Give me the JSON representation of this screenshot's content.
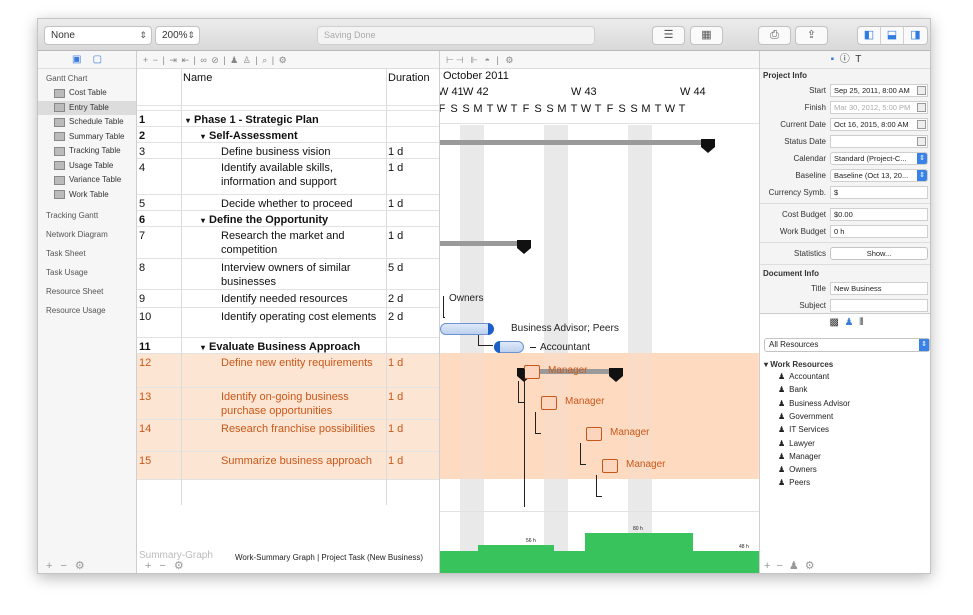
{
  "toolbar": {
    "filter": "None",
    "zoom": "200%",
    "status": "Saving Done"
  },
  "sidebar": {
    "header_icons": [
      "gantt-chart-icon",
      "comment-icon"
    ],
    "gantt_chart": "Gantt Chart",
    "tables": [
      {
        "label": "Cost Table",
        "selected": false
      },
      {
        "label": "Entry Table",
        "selected": true
      },
      {
        "label": "Schedule Table",
        "selected": false
      },
      {
        "label": "Summary Table",
        "selected": false
      },
      {
        "label": "Tracking Table",
        "selected": false
      },
      {
        "label": "Usage Table",
        "selected": false
      },
      {
        "label": "Variance Table",
        "selected": false
      },
      {
        "label": "Work Table",
        "selected": false
      }
    ],
    "views": [
      "Tracking Gantt",
      "Network Diagram",
      "Task Sheet",
      "Task Usage",
      "Resource Sheet",
      "Resource Usage"
    ]
  },
  "table": {
    "col_name": "Name",
    "col_duration": "Duration",
    "rows": [
      {
        "id": "1",
        "name": "Phase 1 - Strategic Plan",
        "duration": "",
        "level": 0,
        "bold": true,
        "orange": false
      },
      {
        "id": "2",
        "name": "Self-Assessment",
        "duration": "",
        "level": 1,
        "bold": true,
        "orange": false
      },
      {
        "id": "3",
        "name": "Define business vision",
        "duration": "1 d",
        "level": 2,
        "bold": false,
        "orange": false
      },
      {
        "id": "4",
        "name": "Identify available skills, information and support",
        "duration": "1 d",
        "level": 2,
        "bold": false,
        "orange": false
      },
      {
        "id": "5",
        "name": "Decide whether to proceed",
        "duration": "1 d",
        "level": 2,
        "bold": false,
        "orange": false
      },
      {
        "id": "6",
        "name": "Define the Opportunity",
        "duration": "",
        "level": 1,
        "bold": true,
        "orange": false
      },
      {
        "id": "7",
        "name": "Research the market and competition",
        "duration": "1 d",
        "level": 2,
        "bold": false,
        "orange": false
      },
      {
        "id": "8",
        "name": "Interview owners of similar businesses",
        "duration": "5 d",
        "level": 2,
        "bold": false,
        "orange": false
      },
      {
        "id": "9",
        "name": "Identify needed resources",
        "duration": "2 d",
        "level": 2,
        "bold": false,
        "orange": false
      },
      {
        "id": "10",
        "name": "Identify operating cost elements",
        "duration": "2 d",
        "level": 2,
        "bold": false,
        "orange": false
      },
      {
        "id": "11",
        "name": "Evaluate Business Approach",
        "duration": "",
        "level": 1,
        "bold": true,
        "orange": false
      },
      {
        "id": "12",
        "name": "Define new entity requirements",
        "duration": "1 d",
        "level": 2,
        "bold": false,
        "orange": true
      },
      {
        "id": "13",
        "name": "Identify on-going business purchase opportunities",
        "duration": "1 d",
        "level": 2,
        "bold": false,
        "orange": true
      },
      {
        "id": "14",
        "name": "Research franchise possibilities",
        "duration": "1 d",
        "level": 2,
        "bold": false,
        "orange": true
      },
      {
        "id": "15",
        "name": "Summarize business approach",
        "duration": "1 d",
        "level": 2,
        "bold": false,
        "orange": true
      }
    ],
    "summary_label": "Summary-Graph",
    "summary_title": "Work-Summary Graph | Project Task (New Business)"
  },
  "gantt": {
    "month": "October 2011",
    "weeks": [
      "W 41",
      "W 42",
      "W 43",
      "W 44"
    ],
    "days": [
      "F",
      "S",
      "S",
      "M",
      "T",
      "W",
      "T",
      "F",
      "S",
      "S",
      "M",
      "T",
      "W",
      "T",
      "F",
      "S",
      "S",
      "M",
      "T",
      "W",
      "T"
    ],
    "labels": {
      "owners": "Owners",
      "advisor": "Business Advisor; Peers",
      "accountant": "Accountant",
      "manager": "Manager"
    },
    "graph_values": [
      "56 h",
      "80 h",
      "48 h"
    ],
    "colors": {
      "weekend": "#e9e9e9",
      "highlight": "#fde5d3",
      "orange": "#c8581a",
      "green": "#39c35d"
    }
  },
  "inspector": {
    "project_info": "Project Info",
    "fields": [
      {
        "label": "Start",
        "value": "Sep 25, 2011, 8:00 AM",
        "dim": false
      },
      {
        "label": "Finish",
        "value": "Mar 30, 2012, 5:00 PM",
        "dim": true
      },
      {
        "label": "Current Date",
        "value": "Oct 16, 2015, 8:00 AM",
        "dim": false
      },
      {
        "label": "Status Date",
        "value": "",
        "dim": false
      }
    ],
    "calendar_label": "Calendar",
    "calendar_value": "Standard (Project-C...",
    "baseline_label": "Baseline",
    "baseline_value": "Baseline (Oct 13, 20...",
    "currency_label": "Currency Symb.",
    "currency_value": "$",
    "cost_budget_label": "Cost Budget",
    "cost_budget_value": "$0.00",
    "work_budget_label": "Work Budget",
    "work_budget_value": "0 h",
    "statistics_label": "Statistics",
    "statistics_button": "Show...",
    "document_info": "Document Info",
    "title_label": "Title",
    "title_value": "New Business",
    "subject_label": "Subject",
    "subject_value": ""
  },
  "resources": {
    "filter": "All Resources",
    "group": "Work Resources",
    "items": [
      "Accountant",
      "Bank",
      "Business Advisor",
      "Government",
      "IT Services",
      "Lawyer",
      "Manager",
      "Owners",
      "Peers"
    ]
  }
}
